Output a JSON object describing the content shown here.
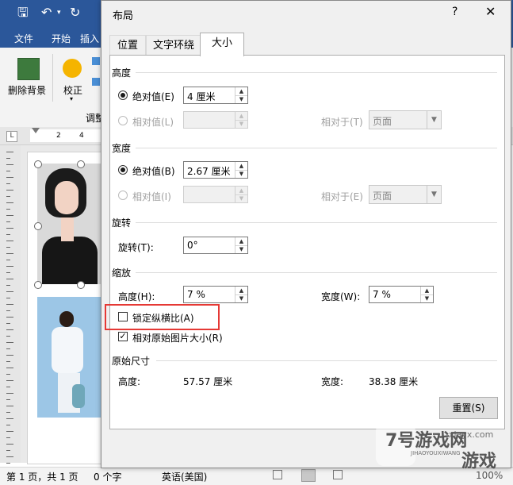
{
  "word": {
    "ribbon_tabs": [
      "文件",
      "开始",
      "插入"
    ],
    "ribbon": {
      "remove_bg": "删除背景",
      "correct": "校正",
      "adjust_group": "调整"
    },
    "ruler_marks": [
      "2",
      "4"
    ],
    "ruler_corner": "L",
    "status": {
      "page": "第 1 页，共 1 页",
      "words": "0 个字",
      "lang": "英语(美国)",
      "zoom": "100%"
    }
  },
  "dialog": {
    "title": "布局",
    "help": "?",
    "close": "✕",
    "tabs": [
      {
        "label": "位置",
        "active": false
      },
      {
        "label": "文字环绕",
        "active": false
      },
      {
        "label": "大小",
        "active": true
      }
    ],
    "height": {
      "section": "高度",
      "absolute_label": "绝对值(E)",
      "absolute_value": "4 厘米",
      "relative_label": "相对值(L)",
      "relative_value": "",
      "relative_to_label": "相对于(T)",
      "relative_to_value": "页面"
    },
    "width": {
      "section": "宽度",
      "absolute_label": "绝对值(B)",
      "absolute_value": "2.67 厘米",
      "relative_label": "相对值(I)",
      "relative_value": "",
      "relative_to_label": "相对于(E)",
      "relative_to_value": "页面"
    },
    "rotate": {
      "section": "旋转",
      "label": "旋转(T):",
      "value": "0°"
    },
    "scale": {
      "section": "缩放",
      "height_label": "高度(H):",
      "height_value": "7 %",
      "width_label": "宽度(W):",
      "width_value": "7 %",
      "lock_aspect_label": "锁定纵横比(A)",
      "lock_aspect_checked": false,
      "relative_original_label": "相对原始图片大小(R)",
      "relative_original_checked": true
    },
    "original": {
      "section": "原始尺寸",
      "height_label": "高度:",
      "height_value": "57.57 厘米",
      "width_label": "宽度:",
      "width_value": "38.38 厘米"
    },
    "reset_button": "重置(S)"
  },
  "watermark": {
    "line1": "7号游戏网",
    "line2": "游戏",
    "url": "xiayx.com",
    "pinyin": "JIHAOYOUXIWANG"
  },
  "colors": {
    "word_blue": "#2b579a",
    "highlight_red": "#e53935"
  }
}
